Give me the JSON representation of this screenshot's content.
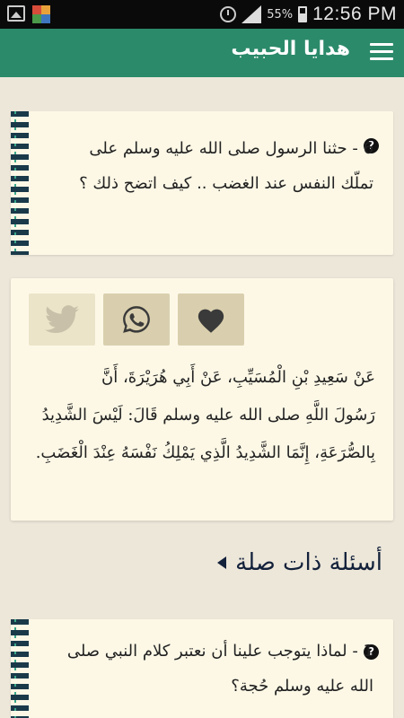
{
  "status_bar": {
    "battery": "55%",
    "time": "12:56 PM",
    "icons": [
      "image-icon",
      "app-icon",
      "alarm-icon",
      "signal-icon",
      "battery-icon"
    ]
  },
  "app_bar": {
    "title": "هدايا الحبيب",
    "menu_icon": "menu-icon",
    "color": "#2b8a6a"
  },
  "question": {
    "text": "6 - حثنا الرسول صلى الله عليه وسلم على تملّك النفس عند الغضب .. كيف اتضح ذلك ؟",
    "icon": "question-icon"
  },
  "share": {
    "buttons": [
      "twitter-icon",
      "whatsapp-icon",
      "heart-icon"
    ]
  },
  "hadith": {
    "line1": "عَنْ سَعِيدِ بْنِ الْمُسَيِّبِ، عَنْ أَبِي هُرَيْرَةَ، أَنَّ",
    "line2": "رَسُولَ اللَّهِ صلى الله عليه وسلم قَالَ: لَيْسَ الشَّدِيدُ بِالصُّرَعَةِ، إِنَّمَا الشَّدِيدُ الَّذِي يَمْلِكُ نَفْسَهُ عِنْدَ الْغَضَبِ."
  },
  "related": {
    "title": "أسئلة ذات صلة",
    "items": [
      {
        "text": "1 - لماذا يتوجب علينا أن نعتبر كلام النبي صلى الله عليه وسلم حُجة؟"
      }
    ]
  }
}
